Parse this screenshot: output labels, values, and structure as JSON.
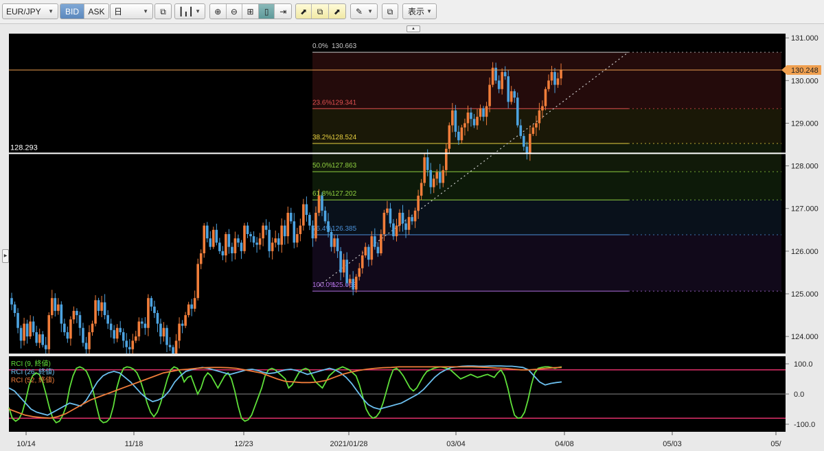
{
  "toolbar": {
    "symbol": "EUR/JPY",
    "bid_label": "BID",
    "ask_label": "ASK",
    "timeframe": "日",
    "display_label": "表示"
  },
  "colors": {
    "up": "#f07d3a",
    "down": "#4da3e0",
    "price_line": "#f0a050",
    "hline": "#ffffff",
    "rci9": "#5fe03a",
    "rci26": "#6cc0f0",
    "rci52": "#f07d3a",
    "rci_band": "#e0306a"
  },
  "chart_data": [
    {
      "type": "candlestick",
      "ylim": [
        123.6,
        131.1
      ],
      "y_ticks": [
        "131.000",
        "130.000",
        "129.000",
        "128.000",
        "127.000",
        "126.000",
        "125.000",
        "124.000"
      ],
      "x_ticks": [
        "10/14",
        "11/18",
        "12/23",
        "2021/01/28",
        "03/04",
        "04/08",
        "05/03",
        "05/"
      ],
      "current_price": "130.248",
      "horizontal_line": "128.293",
      "fibonacci": [
        {
          "label": "0.0%",
          "value": "130.663",
          "color": "#c8c8c8"
        },
        {
          "label": "23.6%",
          "value": "129.341",
          "color": "#e05050"
        },
        {
          "label": "38.2%",
          "value": "128.524",
          "color": "#e8d040"
        },
        {
          "label": "50.0%",
          "value": "127.863",
          "color": "#90d040"
        },
        {
          "label": "61.8%",
          "value": "127.202",
          "color": "#90d040"
        },
        {
          "label": "76.4%",
          "value": "126.385",
          "color": "#4a90d8"
        },
        {
          "label": "100.0%",
          "value": "125.063",
          "color": "#b070e0"
        }
      ],
      "closes": [
        124.75,
        124.55,
        124.2,
        123.9,
        124.3,
        124.0,
        124.35,
        124.1,
        123.85,
        124.05,
        123.8,
        123.7,
        124.5,
        124.9,
        124.6,
        124.75,
        124.3,
        124.1,
        123.95,
        124.4,
        124.6,
        124.5,
        124.2,
        123.85,
        123.7,
        124.1,
        124.3,
        124.85,
        124.6,
        124.8,
        124.5,
        124.3,
        124.15,
        123.95,
        124.2,
        124.1,
        123.9,
        123.75,
        123.7,
        123.9,
        124.0,
        124.35,
        124.3,
        124.2,
        124.9,
        124.7,
        124.55,
        124.3,
        124.0,
        124.2,
        123.8,
        123.75,
        123.6,
        123.9,
        124.3,
        124.25,
        124.5,
        124.75,
        124.65,
        124.9,
        125.7,
        125.95,
        126.6,
        126.3,
        126.1,
        126.5,
        126.2,
        126.0,
        125.9,
        126.4,
        126.1,
        125.95,
        126.3,
        126.2,
        126.0,
        126.6,
        126.4,
        126.35,
        126.2,
        126.15,
        126.3,
        126.6,
        126.5,
        126.0,
        126.2,
        126.3,
        126.15,
        126.6,
        126.35,
        126.9,
        126.7,
        126.2,
        126.4,
        126.6,
        127.1,
        126.85,
        126.6,
        126.3,
        126.9,
        127.3,
        126.95,
        126.7,
        126.45,
        126.1,
        126.3,
        126.0,
        125.5,
        125.8,
        125.25,
        125.35,
        125.1,
        125.4,
        125.6,
        125.9,
        126.1,
        125.8,
        126.35,
        126.1,
        125.95,
        126.4,
        126.9,
        127.0,
        126.65,
        126.35,
        126.6,
        126.9,
        126.65,
        126.5,
        126.8,
        126.7,
        126.95,
        127.3,
        127.6,
        128.2,
        127.9,
        127.5,
        127.7,
        127.85,
        127.6,
        127.9,
        128.4,
        128.95,
        129.3,
        128.8,
        128.6,
        128.9,
        129.0,
        129.25,
        129.1,
        128.95,
        129.15,
        129.35,
        129.15,
        129.4,
        129.9,
        130.3,
        130.0,
        129.8,
        130.2,
        130.1,
        129.5,
        129.75,
        129.6,
        128.95,
        128.7,
        128.45,
        128.3,
        128.75,
        128.9,
        129.0,
        129.3,
        129.4,
        129.8,
        130.0,
        130.2,
        129.9,
        130.05,
        130.248
      ],
      "rci": {
        "ylim": [
          -125,
          125
        ],
        "y_ticks": [
          "100.0",
          "0.0",
          "-100.0"
        ],
        "series": [
          {
            "name": "RCI (9, 終値)",
            "color": "#5fe03a",
            "values": [
              -45,
              -80,
              -90,
              -82,
              -60,
              -20,
              30,
              60,
              70,
              65,
              40,
              0,
              -45,
              -80,
              -95,
              -90,
              -70,
              -40,
              20,
              60,
              85,
              90,
              85,
              75,
              50,
              10,
              -40,
              -85,
              -95,
              -92,
              -80,
              -40,
              20,
              60,
              85,
              90,
              88,
              82,
              70,
              45,
              10,
              -30,
              -60,
              -75,
              -60,
              -30,
              10,
              50,
              80,
              90,
              85,
              70,
              40,
              55,
              60,
              30,
              0,
              20,
              55,
              70,
              60,
              40,
              20,
              40,
              60,
              70,
              50,
              10,
              -40,
              -80,
              -90,
              -85,
              -70,
              -40,
              -10,
              20,
              60,
              80,
              85,
              80,
              70,
              60,
              50,
              20,
              30,
              50,
              70,
              80,
              85,
              80,
              60,
              40,
              30,
              20,
              40,
              60,
              70,
              80,
              85,
              90,
              85,
              80,
              70,
              60,
              30,
              -10,
              -50,
              -70,
              -80,
              -75,
              -60,
              -30,
              10,
              50,
              80,
              85,
              75,
              60,
              40,
              20,
              10,
              20,
              40,
              60,
              75,
              80,
              85,
              88,
              90,
              88,
              85,
              80,
              70,
              60,
              50,
              55,
              60,
              65,
              60,
              55,
              58,
              62,
              65,
              60,
              55,
              70,
              80,
              60,
              20,
              -30,
              -70,
              -80,
              -78,
              -60,
              -20,
              30,
              70,
              85,
              88,
              90,
              90,
              88,
              85,
              88,
              90
            ],
            "visible_points": 0
          },
          {
            "name": "RCI (26, 終値)",
            "color": "#6cc0f0",
            "values": [
              20,
              10,
              -10,
              -30,
              -50,
              -60,
              -65,
              -70,
              -60,
              -50,
              -40,
              -30,
              -35,
              -40,
              -20,
              10,
              40,
              60,
              70,
              75,
              70,
              55,
              40,
              20,
              0,
              -15,
              -25,
              -20,
              -10,
              10,
              40,
              60,
              75,
              80,
              85,
              88,
              85,
              80,
              75,
              70,
              65,
              70,
              75,
              80,
              82,
              78,
              72,
              68,
              70,
              75,
              80,
              82,
              78,
              72,
              65,
              70,
              75,
              80,
              85,
              80,
              70,
              55,
              35,
              10,
              -15,
              -35,
              -45,
              -50,
              -45,
              -40,
              -35,
              -30,
              -20,
              -10,
              0,
              15,
              35,
              55,
              70,
              80,
              88,
              90,
              92,
              93,
              93,
              92,
              92,
              93,
              93,
              93,
              92,
              92,
              90,
              88,
              80,
              60,
              40,
              30,
              35,
              38,
              40
            ],
            "visible_points": 0
          },
          {
            "name": "RCI (52, 終値)",
            "color": "#f07d3a",
            "values": [
              -50,
              -60,
              -70,
              -75,
              -78,
              -80,
              -75,
              -65,
              -50,
              -35,
              -20,
              -10,
              0,
              10,
              20,
              30,
              40,
              50,
              60,
              70,
              75,
              80,
              82,
              85,
              87,
              88,
              88,
              87,
              85,
              80,
              75,
              70,
              60,
              50,
              42,
              40,
              38,
              38,
              40,
              45,
              55,
              65,
              72,
              78,
              82,
              85,
              87,
              88,
              90,
              90,
              90,
              90,
              90,
              90,
              90,
              90,
              90,
              90,
              89,
              88,
              86,
              85,
              82,
              80,
              80,
              82,
              85,
              87,
              88
            ],
            "visible_points": 0
          }
        ]
      }
    }
  ]
}
